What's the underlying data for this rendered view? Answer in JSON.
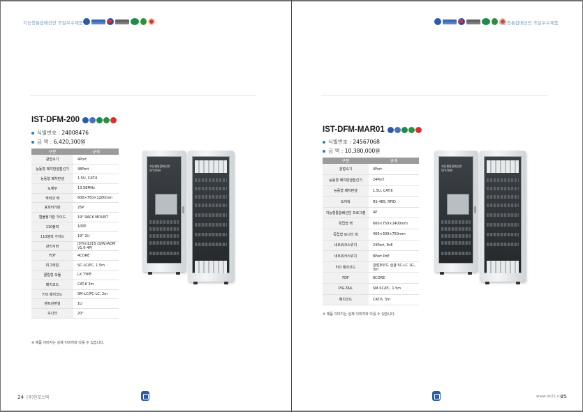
{
  "header": {
    "brand_text": "지능형통합배선반 조달우수제품"
  },
  "left": {
    "product": {
      "name": "IST-DFM-200",
      "id_label": "식별번호 :",
      "id_value": "24008476",
      "price_label": "금      액 :",
      "price_value": "6,420,300원"
    },
    "table_headers": [
      "구분",
      "규격"
    ],
    "rows": [
      [
        "광접속기",
        "4Port"
      ],
      [
        "능동형 패치판넬접선기",
        "48Port"
      ],
      [
        "능동형 패치판넬",
        "1.5U, CAT.6"
      ],
      [
        "도체부",
        "13.56MHz"
      ],
      [
        "캐비넷 랙",
        "600×750×1200mm"
      ],
      [
        "표피어가판",
        "25P"
      ],
      [
        "캠블정가판 가이드",
        "19\" RACK MOUNT"
      ],
      [
        "110블럭",
        "100P"
      ],
      [
        "110블럭 가이드",
        "19\" 2U"
      ],
      [
        "관리서버",
        "ISTim1215 (S/W:iADM V1.0-4P)"
      ],
      [
        "FDF",
        "4CORE"
      ],
      [
        "피그테일",
        "SC-LC/PC, 1.5m"
      ],
      [
        "클립형 모듈",
        "LX TYPE"
      ],
      [
        "패치코드",
        "CAT.6 3m"
      ],
      [
        "F/O 패치코드",
        "SM-LC/PC-LC, 2m"
      ],
      [
        "랜트관판넬",
        "1U"
      ],
      [
        "모니터",
        "20\""
      ]
    ],
    "note": "※ 제품 이미지는 실제 이미지와 다를 수 있습니다.",
    "page_number": "24",
    "company": "(주)인포스텍"
  },
  "right": {
    "product": {
      "name": "IST-DFM-MAR01",
      "id_label": "식별번호 :",
      "id_value": "24567068",
      "price_label": "금      액 :",
      "price_value": "10,380,000원"
    },
    "table_headers": [
      "구분",
      "규격"
    ],
    "rows": [
      [
        "광접속기",
        "4Port"
      ],
      [
        "능동형 패치판넬접선기",
        "24Port"
      ],
      [
        "능동형 패치판넬",
        "1.5U, CAT.6"
      ],
      [
        "도어락",
        "RS-485, RFID"
      ],
      [
        "지능형통합배선반 프로그램",
        "4P"
      ],
      [
        "독립형 랙",
        "600×750×1400mm"
      ],
      [
        "독립형 모니터 랙",
        "400×300×750mm"
      ],
      [
        "네트워크스위치",
        "24Port, PoE"
      ],
      [
        "네트워크스위치",
        "8Port  PoE"
      ],
      [
        "F/O 패치코드",
        "광점퍼코드 심글 SC-LC 1G., 3m"
      ],
      [
        "FDF",
        "8CORE"
      ],
      [
        "PIG-TAIL",
        "SM-SC/PC, 1.5m"
      ],
      [
        "패치코드",
        "CAT.6, 3m"
      ]
    ],
    "note": "※ 제품 이미지는 실제 이미지와 다를 수 있습니다.",
    "page_number": "25",
    "site": "www.ist21.net"
  },
  "cabinet_label": {
    "line1": "지능형통합배선반",
    "line2": "SYSTEM"
  }
}
